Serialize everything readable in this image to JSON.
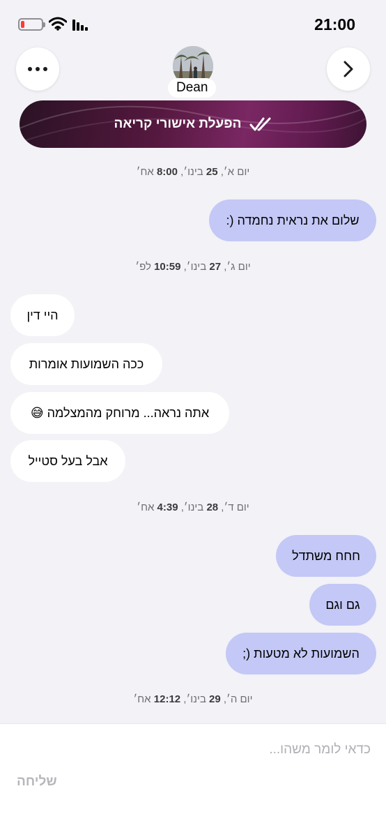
{
  "status_bar": {
    "time": "21:00"
  },
  "header": {
    "contact_name": "Dean"
  },
  "banner": {
    "label": "הפעלת אישורי קריאה"
  },
  "messages": [
    {
      "type": "date",
      "text": "יום א׳, 25 בינו׳, 8:00 אח׳"
    },
    {
      "type": "sent",
      "text": "שלום את נראית נחמדה (:"
    },
    {
      "type": "date",
      "text": "יום ג׳, 27 בינו׳, 10:59 לפ׳"
    },
    {
      "type": "received",
      "text": "היי דין"
    },
    {
      "type": "received",
      "text": "ככה השמועות אומרות"
    },
    {
      "type": "received",
      "text": "אתה נראה... מרוחק מהמצלמה 😅"
    },
    {
      "type": "received",
      "text": "אבל בעל סטייל"
    },
    {
      "type": "date",
      "text": "יום ד׳, 28 בינו׳, 4:39 אח׳"
    },
    {
      "type": "sent",
      "text": "חחח משתדל"
    },
    {
      "type": "sent",
      "text": "גם וגם"
    },
    {
      "type": "sent",
      "text": "השמועות לא מטעות (;"
    },
    {
      "type": "date",
      "text": "יום ה׳, 29 בינו׳, 12:12 אח׳"
    }
  ],
  "composer": {
    "placeholder": "כדאי לומר משהו...",
    "send_label": "שליחה"
  },
  "colors": {
    "background": "#f2f2f7",
    "sent_bubble": "#c4c8f6",
    "received_bubble": "#ffffff",
    "banner": "#5e1a4d",
    "battery_low": "#ff3b30"
  },
  "icons": [
    "battery-icon",
    "wifi-icon",
    "signal-icon",
    "more-icon",
    "chevron-right-icon",
    "double-check-icon"
  ]
}
